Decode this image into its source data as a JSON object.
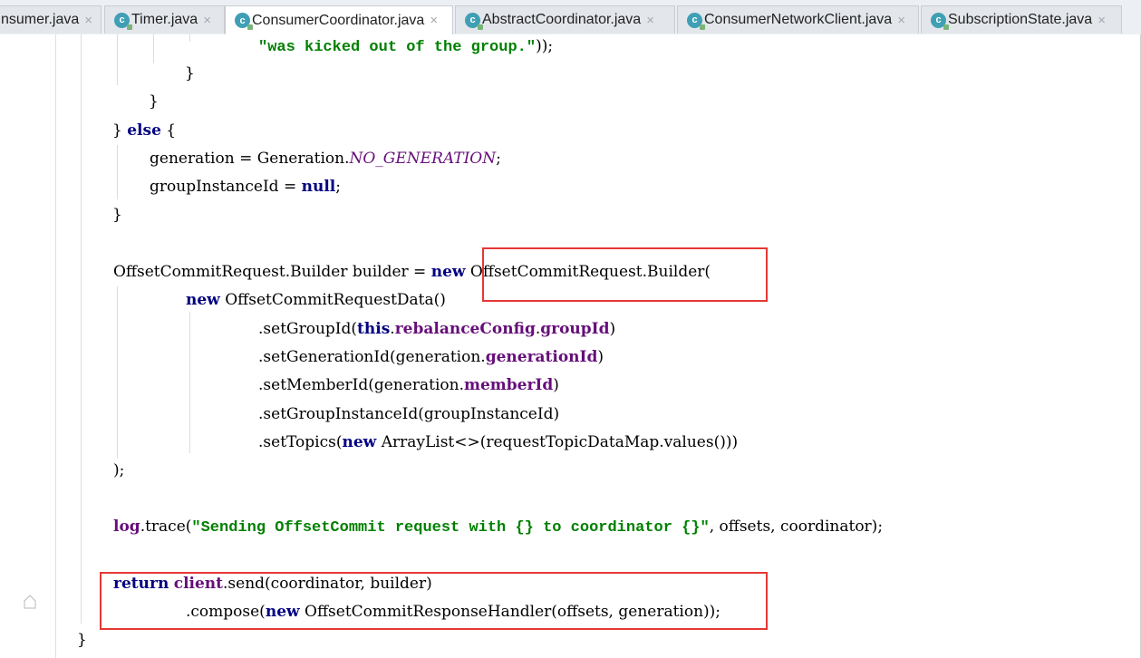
{
  "tabs": [
    {
      "label": "nsumer.java",
      "icon": "",
      "active": false
    },
    {
      "label": "Timer.java",
      "icon": "class-icon",
      "active": false
    },
    {
      "label": "ConsumerCoordinator.java",
      "icon": "class-icon",
      "active": true
    },
    {
      "label": "AbstractCoordinator.java",
      "icon": "class-icon",
      "active": false
    },
    {
      "label": "ConsumerNetworkClient.java",
      "icon": "class-icon",
      "active": false
    },
    {
      "label": "SubscriptionState.java",
      "icon": "class-icon",
      "active": false
    }
  ],
  "close_glyph": "×",
  "class_icon_glyph": "c",
  "code": {
    "l1_str": "\"was kicked out of the group.\"",
    "l1_end": "));",
    "l2": "}",
    "l3": "}",
    "l4_brace": "} ",
    "l4_kw": "else",
    "l4_end": " {",
    "l5_a": "generation = Generation.",
    "l5_static": "NO_GENERATION",
    "l5_end": ";",
    "l6_a": "groupInstanceId = ",
    "l6_kw": "null",
    "l6_end": ";",
    "l7": "}",
    "l8_a": "OffsetCommitRequest.Builder builder = ",
    "l8_kw": "new",
    "l8_b": " OffsetCommitRequest.Builder(",
    "l9_kw": "new",
    "l9_b": " OffsetCommitRequestData()",
    "l10_a": ".setGroupId(",
    "l10_kw": "this",
    "l10_b": ".",
    "l10_f1": "rebalanceConfig",
    "l10_c": ".",
    "l10_f2": "groupId",
    "l10_end": ")",
    "l11_a": ".setGenerationId(generation.",
    "l11_f": "generationId",
    "l11_end": ")",
    "l12_a": ".setMemberId(generation.",
    "l12_f": "memberId",
    "l12_end": ")",
    "l13": ".setGroupInstanceId(groupInstanceId)",
    "l14_a": ".setTopics(",
    "l14_kw": "new",
    "l14_b": " ArrayList<>(requestTopicDataMap.values()))",
    "l15": ");",
    "l16_f": "log",
    "l16_a": ".trace(",
    "l16_str": "\"Sending OffsetCommit request with {} to coordinator {}\"",
    "l16_end": ", offsets, coordinator);",
    "l17_kw": "return",
    "l17_sp": " ",
    "l17_f": "client",
    "l17_a": ".send(coordinator, builder)",
    "l18_a": ".compose(",
    "l18_kw": "new",
    "l18_b": " OffsetCommitResponseHandler(offsets, generation));",
    "l19": "}"
  },
  "colors": {
    "keyword": "#000080",
    "string": "#008000",
    "field": "#660e7a",
    "highlight_box": "#e53935"
  }
}
